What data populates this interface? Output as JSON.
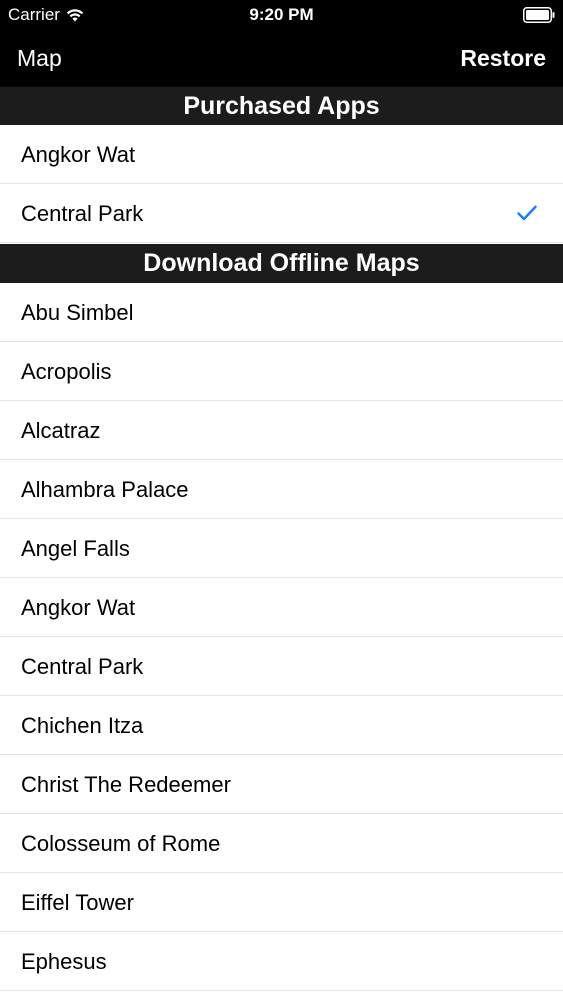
{
  "status_bar": {
    "carrier": "Carrier",
    "time": "9:20 PM",
    "wifi_icon": "wifi-icon",
    "battery_icon": "battery-icon"
  },
  "nav": {
    "left_label": "Map",
    "right_label": "Restore"
  },
  "sections": {
    "purchased": {
      "title": "Purchased Apps",
      "items": [
        {
          "label": "Angkor Wat",
          "checked": false
        },
        {
          "label": "Central Park",
          "checked": true
        }
      ]
    },
    "download": {
      "title": "Download Offline Maps",
      "items": [
        {
          "label": "Abu Simbel"
        },
        {
          "label": "Acropolis"
        },
        {
          "label": "Alcatraz"
        },
        {
          "label": "Alhambra Palace"
        },
        {
          "label": "Angel Falls"
        },
        {
          "label": "Angkor Wat"
        },
        {
          "label": "Central Park"
        },
        {
          "label": "Chichen Itza"
        },
        {
          "label": "Christ The Redeemer"
        },
        {
          "label": "Colosseum of Rome"
        },
        {
          "label": "Eiffel Tower"
        },
        {
          "label": "Ephesus"
        }
      ]
    }
  },
  "colors": {
    "bar_background": "#000000",
    "section_header_background": "#1c1c1c",
    "checkmark": "#147efb",
    "separator": "#e2e2e4"
  }
}
